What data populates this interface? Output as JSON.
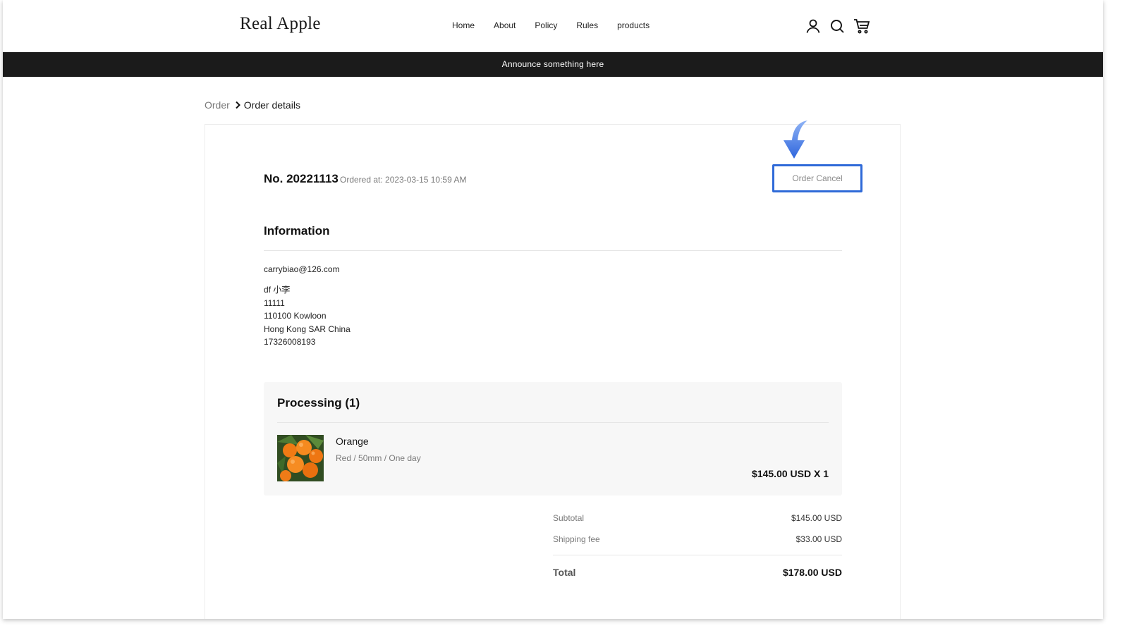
{
  "header": {
    "logo": "Real Apple",
    "nav": [
      "Home",
      "About",
      "Policy",
      "Rules",
      "products"
    ]
  },
  "announcement": "Announce something here",
  "breadcrumb": {
    "parent": "Order",
    "current": "Order details"
  },
  "order": {
    "number": "No. 20221113",
    "ordered_at": "Ordered at: 2023-03-15 10:59 AM",
    "cancel_label": "Order Cancel"
  },
  "information": {
    "title": "Information",
    "email": "carrybiao@126.com",
    "lines": [
      "df 小李",
      "11111",
      "110100 Kowloon",
      "Hong Kong SAR China",
      "17326008193"
    ]
  },
  "processing": {
    "title": "Processing (1)",
    "item": {
      "name": "Orange",
      "variant": "Red / 50mm / One day",
      "price": "$145.00 USD X 1"
    }
  },
  "totals": {
    "subtotal_label": "Subtotal",
    "subtotal_value": "$145.00 USD",
    "shipping_label": "Shipping fee",
    "shipping_value": "$33.00 USD",
    "total_label": "Total",
    "total_value": "$178.00 USD"
  },
  "colors": {
    "accent": "#2f6ad8",
    "announce_bg": "#1b1b1b",
    "arrow": "#4a7fe6"
  },
  "icons": [
    "user-icon",
    "search-icon",
    "cart-icon",
    "chevron-right-icon",
    "down-arrow-icon"
  ]
}
